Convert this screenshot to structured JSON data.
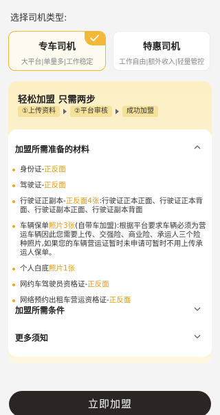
{
  "header": {
    "title": "选择司机类型:"
  },
  "driver_types": [
    {
      "title": "专车司机",
      "subtitle": "大平台|单量多|工作稳定",
      "selected": true
    },
    {
      "title": "特惠司机",
      "subtitle": "工作自由|额外收入|轻量管控",
      "selected": false
    }
  ],
  "intro": {
    "title": "轻松加盟 只需两步",
    "steps": [
      "①上传资料",
      "②平台审核",
      "成功加盟"
    ]
  },
  "materials": {
    "title": "加盟所需准备的材料",
    "items": [
      {
        "pre": "身份证-",
        "hl1": "正反面",
        "mid": "",
        "hl2": "",
        "post": ""
      },
      {
        "pre": "驾驶证-",
        "hl1": "正反面",
        "mid": "",
        "hl2": "",
        "post": ""
      },
      {
        "pre": "行驶证正副本-",
        "hl1": "正反面4张",
        "mid": "",
        "hl2": "",
        "post": ":行驶证正本正面、行驶证正本背面、行驶证副本正面、行驶证副本背面"
      },
      {
        "pre": "车辆保单",
        "hl1": "照片3张",
        "mid": "",
        "hl2": "",
        "post": "(自带车加盟):根据平台要求车辆必须为营运车辆因此您需要上传、交强险、商业险、承运人三个险种照片,如果您的车辆营运证暂时未申请可暂时不用上传承运人保单。"
      },
      {
        "pre": "个人白底",
        "hl1": "照片1张",
        "mid": "",
        "hl2": "",
        "post": ""
      },
      {
        "pre": "网约车驾驶员资格证-",
        "hl1": "正反面",
        "mid": "",
        "hl2": "",
        "post": ""
      },
      {
        "pre": "网络预约出租车营运资格证-",
        "hl1": "正反面",
        "mid": "",
        "hl2": "",
        "post": ""
      }
    ]
  },
  "conditions": {
    "title": "加盟所需条件"
  },
  "notes": {
    "title": "更多须知"
  },
  "cta": {
    "label": "立即加盟"
  },
  "colors": {
    "accent": "#f3b73a",
    "highlight": "#e69a14",
    "button": "#2b2523"
  }
}
